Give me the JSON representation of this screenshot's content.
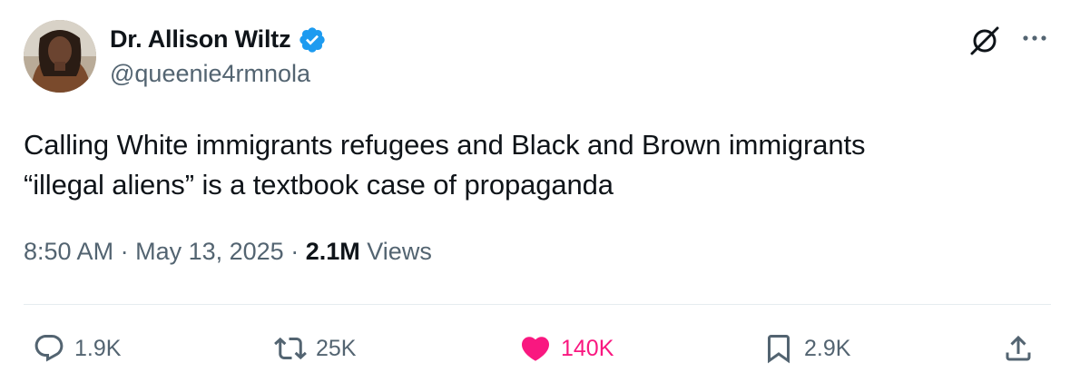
{
  "author": {
    "name": "Dr. Allison Wiltz",
    "handle": "@queenie4rmnola",
    "verified": true
  },
  "tweet": {
    "text": "Calling White immigrants refugees and Black and Brown immigrants\n“illegal aliens” is a textbook case of propaganda"
  },
  "meta": {
    "time": "8:50 AM",
    "separator": "·",
    "date": "May 13, 2025",
    "views_count": "2.1M",
    "views_label": "Views"
  },
  "actions": {
    "replies": "1.9K",
    "reposts": "25K",
    "likes": "140K",
    "bookmarks": "2.9K"
  },
  "icons": {
    "verified": "verified-badge-icon",
    "grok": "grok-icon",
    "more": "more-icon",
    "reply": "reply-icon",
    "repost": "repost-icon",
    "like": "heart-icon",
    "bookmark": "bookmark-icon",
    "share": "share-icon"
  },
  "colors": {
    "text": "#0f1419",
    "secondary": "#536471",
    "verified": "#1d9bf0",
    "like": "#f91880",
    "divider": "#e6ecf0"
  }
}
